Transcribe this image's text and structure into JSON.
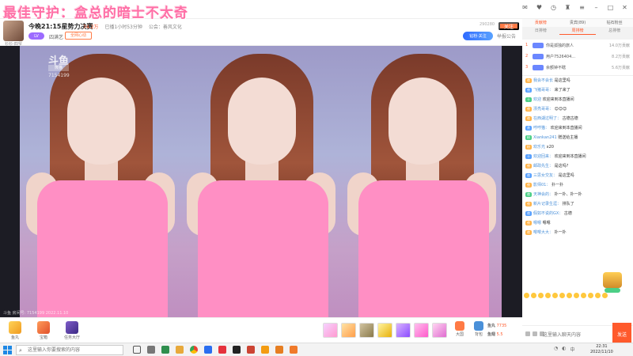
{
  "overlay": {
    "text": "最佳守护：盒总的暗士不太奇"
  },
  "room": {
    "title": "今晚21:15星势力决赛",
    "hot": "74.2万",
    "live_time": "已播1小时53分钟",
    "notice": "公会：善风文化",
    "avatar_caption": "衫衫-四爷",
    "level": "LV",
    "anchor": "四满艺",
    "follow_tag": "全网心动",
    "fans_count": "290280",
    "follow_label": "关注",
    "report_label": "举报公告",
    "badge": "钻粉·关注"
  },
  "video": {
    "watermark": "斗鱼",
    "watermark_sub": "熊猫",
    "room_id": "7154199",
    "footer": "斗鱼 房间号: 7154199   2022.11.10"
  },
  "giftbar": {
    "left": [
      {
        "icon": "gold-box-icon",
        "label": "鱼丸"
      },
      {
        "icon": "treasure-icon",
        "label": "宝箱"
      },
      {
        "icon": "mission-icon",
        "label": "任务大厅"
      }
    ],
    "right": [
      {
        "icon": "boat-icon",
        "label": "大国"
      },
      {
        "icon": "backpack-icon",
        "label": "背包"
      }
    ],
    "wallet": {
      "fish_label": "鱼丸",
      "fish": "7735",
      "coin_label": "鱼翅",
      "coin": "5.5"
    }
  },
  "rank": {
    "tabs": [
      "贡献榜",
      "贵宾(89)",
      "钻石粉丝"
    ],
    "subtabs": [
      "日排榜",
      "周排榜",
      "总排榜"
    ],
    "rows": [
      {
        "num": "1",
        "name": "你是孤独的旅人",
        "value": "14.0万贡献"
      },
      {
        "num": "2",
        "name": "用户7526404...",
        "value": "8.2万贡献"
      },
      {
        "num": "3",
        "name": "余额钟不瞎",
        "value": "5.6万贡献"
      }
    ]
  },
  "chat": {
    "messages": [
      {
        "tag": "夜",
        "tag_color": "",
        "nick": "我会不会长",
        "text": "是这里吗"
      },
      {
        "tag": "夜",
        "tag_color": "blue",
        "nick": "飞猪哥哥：",
        "text": "来了来了"
      },
      {
        "tag": "十",
        "tag_color": "green",
        "nick": "欢迎",
        "text": "欢迎来到本直播间"
      },
      {
        "tag": "夜",
        "tag_color": "",
        "nick": "漂亮哥哥：",
        "text": "😊😊😊"
      },
      {
        "tag": "夜",
        "tag_color": "",
        "nick": "在西湖过明了：",
        "text": "古德古德"
      },
      {
        "tag": "贵",
        "tag_color": "blue",
        "nick": "哼哼猫：",
        "text": "欢迎来到本直播间"
      },
      {
        "tag": "粉",
        "tag_color": "green",
        "nick": "Xiankan241",
        "text": "赠送给主播"
      },
      {
        "tag": "粉",
        "tag_color": "",
        "nick": "欢乐光",
        "text": "x20"
      },
      {
        "tag": "十",
        "tag_color": "blue",
        "nick": "欢迎回来：",
        "text": "欢迎来到本直播间"
      },
      {
        "tag": "夜",
        "tag_color": "",
        "nick": "邮政先生：",
        "text": "是这吗?"
      },
      {
        "tag": "夜",
        "tag_color": "blue",
        "nick": "三思女交友：",
        "text": "是这里吗"
      },
      {
        "tag": "夜",
        "tag_color": "",
        "nick": "影师01：",
        "text": "扑一扑"
      },
      {
        "tag": "夜",
        "tag_color": "green",
        "nick": "天神会的：",
        "text": "扑一扑、扑一扑"
      },
      {
        "tag": "夜",
        "tag_color": "",
        "nick": "新片记录生涯：",
        "text": "排队了"
      },
      {
        "tag": "夜",
        "tag_color": "blue",
        "nick": "假如不说的GX：",
        "text": "古德"
      },
      {
        "tag": "夜",
        "tag_color": "",
        "nick": "嗯嗯",
        "text": "嗯嗯"
      },
      {
        "tag": "夜",
        "tag_color": "",
        "nick": "嘤嘤大大：",
        "text": "扑一扑"
      }
    ],
    "input_placeholder": "这里输入聊天内容",
    "send_label": "发送"
  },
  "taskbar": {
    "search_placeholder": "这里输入你要搜索的内容",
    "time": "22:31",
    "date": "2022/11/10"
  }
}
